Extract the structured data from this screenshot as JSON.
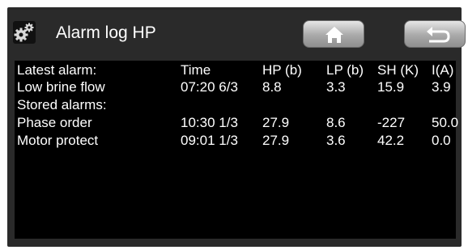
{
  "header": {
    "title": "Alarm log HP",
    "settings_icon": "gears-icon",
    "home_icon": "home-icon",
    "back_icon": "back-arrow-icon"
  },
  "table": {
    "columns": [
      "Latest alarm:",
      "Time",
      "HP (b)",
      "LP (b)",
      "SH (K)",
      "I(A)"
    ],
    "latest": [
      {
        "name": "Low brine flow",
        "time": "07:20 6/3",
        "hp": "8.8",
        "lp": "3.3",
        "sh": "15.9",
        "i": "3.9"
      }
    ],
    "stored_label": "Stored alarms:",
    "stored": [
      {
        "name": "Phase order",
        "time": "10:30 1/3",
        "hp": "27.9",
        "lp": "8.6",
        "sh": "-227",
        "i": "50.0"
      },
      {
        "name": "Motor protect",
        "time": "09:01 1/3",
        "hp": "27.9",
        "lp": "3.6",
        "sh": "42.2",
        "i": "0.0"
      }
    ]
  },
  "colors": {
    "background": "#2a2a2a",
    "panel": "#000000",
    "text": "#ffffff"
  }
}
